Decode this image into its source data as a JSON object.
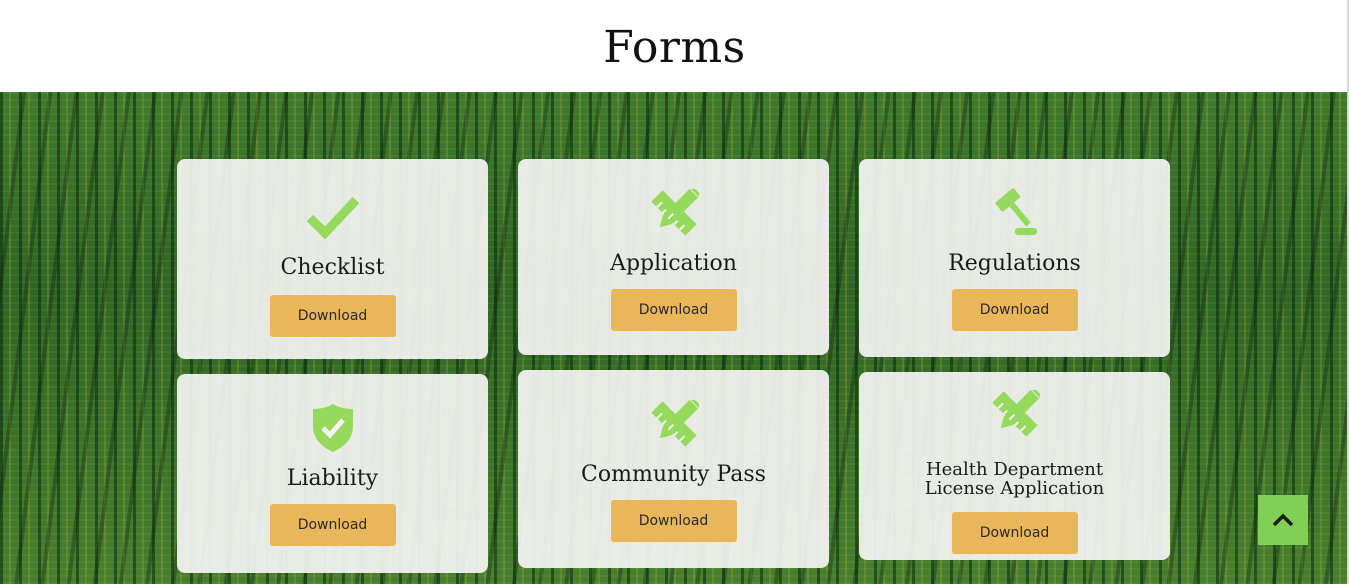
{
  "page": {
    "title": "Forms"
  },
  "cards": [
    {
      "title": "Checklist",
      "icon": "checkmark-icon",
      "button": "Download"
    },
    {
      "title": "Application",
      "icon": "pencil-ruler-icon",
      "button": "Download"
    },
    {
      "title": "Regulations",
      "icon": "gavel-icon",
      "button": "Download"
    },
    {
      "title": "Liability",
      "icon": "shield-check-icon",
      "button": "Download"
    },
    {
      "title": "Community Pass",
      "icon": "pencil-ruler-icon",
      "button": "Download"
    },
    {
      "title_line1": "Health Department",
      "title_line2": "License Application",
      "icon": "pencil-ruler-icon",
      "button": "Download"
    }
  ],
  "back_to_top": {
    "icon": "chevron-up-icon"
  },
  "colors": {
    "icon_green": "#95d95d",
    "button_gold": "#eab65a",
    "back_to_top_green": "#82cf56"
  }
}
